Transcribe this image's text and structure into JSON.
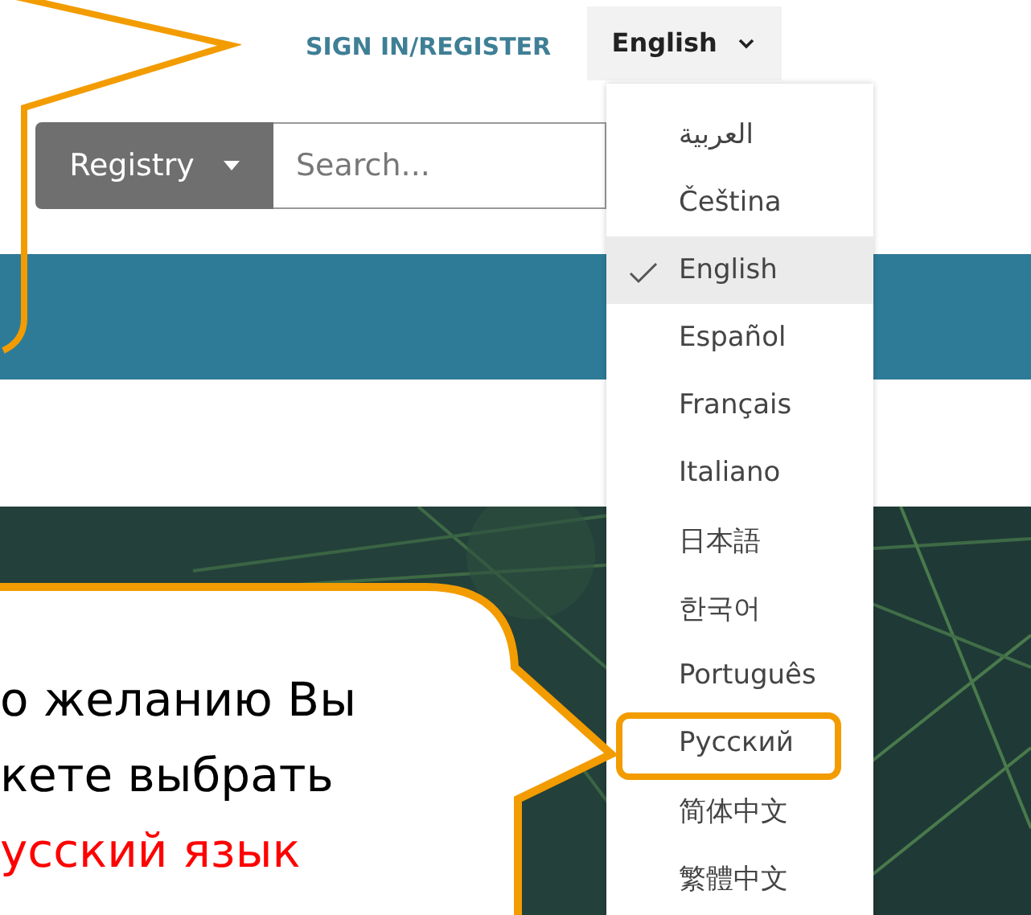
{
  "header": {
    "sign_in": "SIGN IN/REGISTER",
    "language_button": "English"
  },
  "search": {
    "scope": "Registry",
    "placeholder": "Search..."
  },
  "language_menu": [
    {
      "label": "العربية",
      "selected": false,
      "framed": false
    },
    {
      "label": "Čeština",
      "selected": false,
      "framed": false
    },
    {
      "label": "English",
      "selected": true,
      "framed": false
    },
    {
      "label": "Español",
      "selected": false,
      "framed": false
    },
    {
      "label": "Français",
      "selected": false,
      "framed": false
    },
    {
      "label": "Italiano",
      "selected": false,
      "framed": false
    },
    {
      "label": "日本語",
      "selected": false,
      "framed": false
    },
    {
      "label": "한국어",
      "selected": false,
      "framed": false
    },
    {
      "label": "Português",
      "selected": false,
      "framed": false
    },
    {
      "label": "Русский",
      "selected": false,
      "framed": true
    },
    {
      "label": "简体中文",
      "selected": false,
      "framed": false
    },
    {
      "label": "繁體中文",
      "selected": false,
      "framed": false
    }
  ],
  "callout": {
    "lines": [
      {
        "text": "о желанию Вы",
        "color": "#000000"
      },
      {
        "text": "кете выбрать",
        "color": "#000000"
      },
      {
        "text": "усский язык",
        "color": "#ff0000"
      }
    ]
  }
}
